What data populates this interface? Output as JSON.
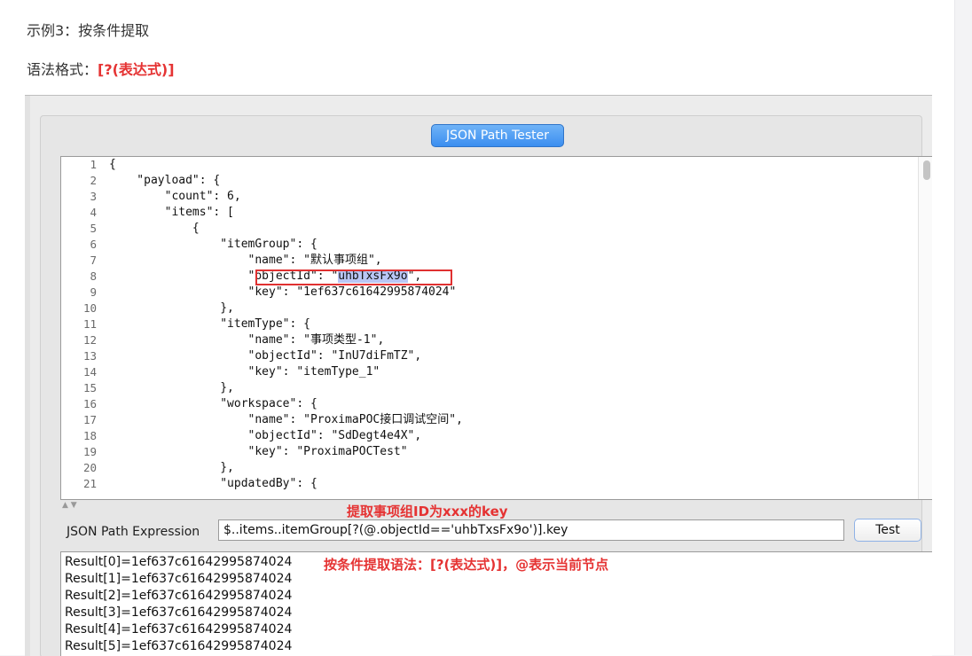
{
  "intro": {
    "example_title": "示例3：按条件提取",
    "syntax_label": "语法格式：",
    "syntax_value": "[?(表达式)]"
  },
  "tester": {
    "title": "JSON Path Tester",
    "line_numbers": [
      "1",
      "2",
      "3",
      "4",
      "5",
      "6",
      "7",
      "8",
      "9",
      "10",
      "11",
      "12",
      "13",
      "14",
      "15",
      "16",
      "17",
      "18",
      "19",
      "20",
      "21"
    ],
    "code_lines": [
      "{",
      "    \"payload\": {",
      "        \"count\": 6,",
      "        \"items\": [",
      "            {",
      "                \"itemGroup\": {",
      "                    \"name\": \"默认事项组\",",
      "                    \"objectId\": \"uhbTxsFx9o\",",
      "                    \"key\": \"1ef637c61642995874024\"",
      "                },",
      "                \"itemType\": {",
      "                    \"name\": \"事项类型-1\",",
      "                    \"objectId\": \"InU7diFmTZ\",",
      "                    \"key\": \"itemType_1\"",
      "                },",
      "                \"workspace\": {",
      "                    \"name\": \"ProximaPOC接口调试空间\",",
      "                    \"objectId\": \"SdDegt4e4X\",",
      "                    \"key\": \"ProximaPOCTest\"",
      "                },",
      "                \"updatedBy\": {"
    ],
    "line8": {
      "pre": "                    \"objectId\": \"",
      "selected": "uhbTxsFx9o",
      "post": "\","
    },
    "annotation_top": "提取事项组ID为xxx的key",
    "expr_label": "JSON Path Expression",
    "expr_value": "$..items..itemGroup[?(@.objectId=='uhbTxsFx9o')].key",
    "test_button": "Test",
    "results": [
      "Result[0]=1ef637c61642995874024",
      "Result[1]=1ef637c61642995874024",
      "Result[2]=1ef637c61642995874024",
      "Result[3]=1ef637c61642995874024",
      "Result[4]=1ef637c61642995874024",
      "Result[5]=1ef637c61642995874024"
    ],
    "annotation_result": "按条件提取语法：[?(表达式)]，@表示当前节点"
  },
  "colors": {
    "accent_red": "#e53333",
    "badge_blue": "#3b8ef0",
    "selection": "#b9c6f5"
  },
  "icons": {
    "split_handle": "split-arrows-icon"
  }
}
